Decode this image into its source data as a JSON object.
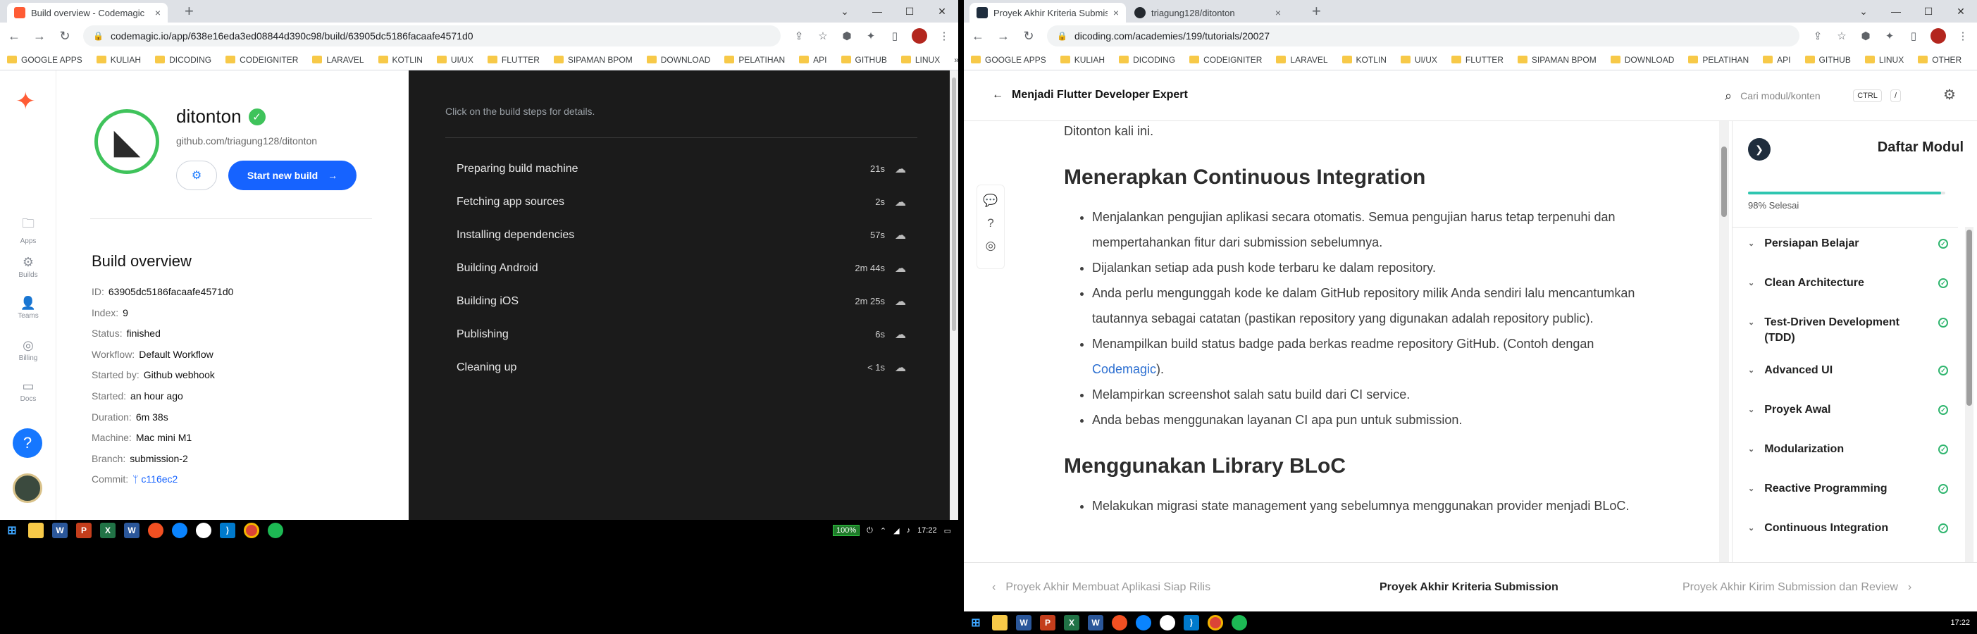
{
  "win1": {
    "tabs": [
      {
        "title": "Build overview - Codemagic",
        "close": "×"
      }
    ],
    "new_tab": "+",
    "window_controls": {
      "minimize": "⌄",
      "min": "—",
      "max": "☐",
      "close": "✕"
    },
    "url": "codemagic.io/app/638e16eda3ed08844d390c98/build/63905dc5186facaafe4571d0",
    "bookmarks": [
      "GOOGLE APPS",
      "KULIAH",
      "DICODING",
      "CODEIGNITER",
      "LARAVEL",
      "KOTLIN",
      "UI/UX",
      "FLUTTER",
      "SIPAMAN BPOM",
      "DOWNLOAD",
      "PELATIHAN",
      "API",
      "GITHUB",
      "LINUX"
    ],
    "bookmark_more": "»"
  },
  "codemagic": {
    "rail": [
      {
        "icon": "folder-icon",
        "glyph": "🗀",
        "label": "Apps"
      },
      {
        "icon": "builds-icon",
        "glyph": "⚙",
        "label": "Builds"
      },
      {
        "icon": "teams-icon",
        "glyph": "👤",
        "label": "Teams"
      },
      {
        "icon": "billing-icon",
        "glyph": "◎",
        "label": "Billing"
      },
      {
        "icon": "docs-icon",
        "glyph": "▭",
        "label": "Docs"
      }
    ],
    "help": "?",
    "app_name": "ditonton",
    "verified": "✓",
    "repo": "github.com/triagung128/ditonton",
    "settings_glyph": "⚙",
    "start_build": "Start new build",
    "start_arrow": "→",
    "overview_title": "Build overview",
    "props": [
      {
        "k": "ID:",
        "v": "63905dc5186facaafe4571d0"
      },
      {
        "k": "Index:",
        "v": "9"
      },
      {
        "k": "Status:",
        "v": "finished"
      },
      {
        "k": "Workflow:",
        "v": "Default Workflow"
      },
      {
        "k": "Started by:",
        "v": "Github webhook"
      },
      {
        "k": "Started:",
        "v": "an hour ago"
      },
      {
        "k": "Duration:",
        "v": "6m 38s"
      },
      {
        "k": "Machine:",
        "v": "Mac mini M1"
      },
      {
        "k": "Branch:",
        "v": "submission-2"
      },
      {
        "k": "Commit:",
        "v": "ᛘ c116ec2"
      }
    ],
    "hint": "Click on the build steps for details.",
    "steps": [
      {
        "name": "Preparing build machine",
        "time": "21s"
      },
      {
        "name": "Fetching app sources",
        "time": "2s"
      },
      {
        "name": "Installing dependencies",
        "time": "57s"
      },
      {
        "name": "Building Android",
        "time": "2m 44s"
      },
      {
        "name": "Building iOS",
        "time": "2m 25s"
      },
      {
        "name": "Publishing",
        "time": "6s"
      },
      {
        "name": "Cleaning up",
        "time": "< 1s"
      }
    ],
    "download_glyph": "☁"
  },
  "taskbar1": {
    "battery": "100%",
    "time": "17:22"
  },
  "win2": {
    "tabs": [
      {
        "title": "Proyek Akhir Kriteria Submission",
        "close": "×"
      },
      {
        "title": "triagung128/ditonton",
        "close": "×"
      }
    ],
    "url": "dicoding.com/academies/199/tutorials/20027",
    "bookmarks": [
      "GOOGLE APPS",
      "KULIAH",
      "DICODING",
      "CODEIGNITER",
      "LARAVEL",
      "KOTLIN",
      "UI/UX",
      "FLUTTER",
      "SIPAMAN BPOM",
      "DOWNLOAD",
      "PELATIHAN",
      "API",
      "GITHUB",
      "LINUX",
      "OTHER"
    ]
  },
  "dicoding": {
    "back_title": "Menjadi Flutter Developer Expert",
    "search_placeholder": "Cari modul/konten",
    "kbd_ctrl": "CTRL",
    "kbd_slash": "/",
    "lead": "Ditonton kali ini.",
    "sections": [
      {
        "title": "Menerapkan Continuous Integration",
        "items": [
          "Menjalankan pengujian aplikasi secara otomatis. Semua pengujian harus tetap terpenuhi dan mempertahankan fitur dari submission sebelumnya.",
          "Dijalankan setiap ada push kode terbaru ke dalam repository.",
          "Anda perlu mengunggah kode ke dalam GitHub repository milik Anda sendiri lalu mencantumkan tautannya sebagai catatan (pastikan repository yang digunakan adalah repository public).",
          "Menampilkan build status badge pada berkas readme repository GitHub. (Contoh dengan ",
          "Melampirkan screenshot salah satu build dari CI service.",
          "Anda bebas menggunakan layanan CI apa pun untuk submission."
        ],
        "link": "Codemagic",
        "link_after": ")."
      },
      {
        "title": "Menggunakan Library BLoC",
        "items": [
          "Melakukan migrasi state management yang sebelumnya menggunakan provider menjadi BLoC."
        ]
      }
    ],
    "panel_title": "Daftar Modul",
    "progress_pct": 98,
    "progress_text": "98% Selesai",
    "modules": [
      "Persiapan Belajar",
      "Clean Architecture",
      "Test-Driven Development (TDD)",
      "Advanced UI",
      "Proyek Awal",
      "Modularization",
      "Reactive Programming",
      "Continuous Integration"
    ],
    "prev": "Proyek Akhir Membuat Aplikasi Siap Rilis",
    "current": "Proyek Akhir Kriteria Submission",
    "next": "Proyek Akhir Kirim Submission dan Review"
  },
  "taskbar2": {
    "time": "17:22"
  }
}
